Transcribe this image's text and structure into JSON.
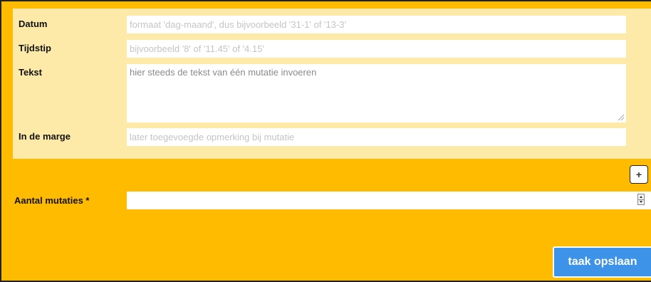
{
  "mutation": {
    "datum": {
      "label": "Datum",
      "placeholder": "formaat 'dag-maand', dus bijvoorbeeld '31-1' of '13-3'"
    },
    "tijdstip": {
      "label": "Tijdstip",
      "placeholder": "bijvoorbeeld '8' of '11.45' of '4.15'"
    },
    "tekst": {
      "label": "Tekst",
      "placeholder": "hier steeds de tekst van één mutatie invoeren"
    },
    "marge": {
      "label": "In de marge",
      "placeholder": "later toegevoegde opmerking bij mutatie"
    }
  },
  "add_button": {
    "symbol": "+"
  },
  "aantal": {
    "label": "Aantal mutaties *",
    "value": ""
  },
  "save_button": {
    "label": "taak opslaan"
  },
  "colors": {
    "background": "#ffbb00",
    "panel": "#fde9a8",
    "button": "#3d93e8"
  }
}
